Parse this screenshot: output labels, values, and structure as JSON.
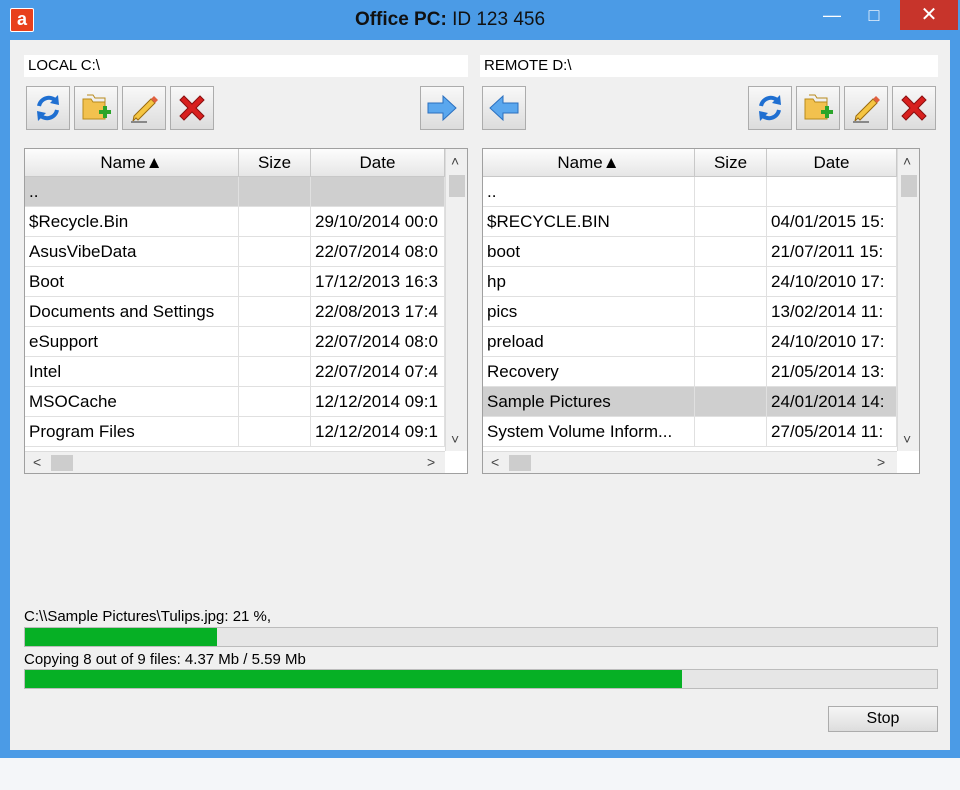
{
  "window": {
    "title_pc": "Office PC:",
    "title_id": " ID 123 456",
    "logo_letter": "a",
    "min_glyph": "—",
    "max_glyph": "□",
    "close_glyph": "✕"
  },
  "local": {
    "path": "LOCAL C:\\",
    "columns": [
      "Name▲",
      "Size",
      "Date"
    ],
    "rows": [
      {
        "name": "..",
        "size": "",
        "date": ""
      },
      {
        "name": "$Recycle.Bin",
        "size": "",
        "date": "29/10/2014  00:0"
      },
      {
        "name": "AsusVibeData",
        "size": "",
        "date": "22/07/2014  08:0"
      },
      {
        "name": "Boot",
        "size": "",
        "date": "17/12/2013  16:3"
      },
      {
        "name": "Documents and Settings",
        "size": "",
        "date": "22/08/2013  17:4"
      },
      {
        "name": "eSupport",
        "size": "",
        "date": "22/07/2014  08:0"
      },
      {
        "name": "Intel",
        "size": "",
        "date": "22/07/2014  07:4"
      },
      {
        "name": "MSOCache",
        "size": "",
        "date": "12/12/2014  09:1"
      },
      {
        "name": "Program Files",
        "size": "",
        "date": "12/12/2014  09:1"
      }
    ],
    "selected_index": 0
  },
  "remote": {
    "path": "REMOTE D:\\",
    "columns": [
      "Name▲",
      "Size",
      "Date"
    ],
    "rows": [
      {
        "name": "..",
        "size": "",
        "date": ""
      },
      {
        "name": "$RECYCLE.BIN",
        "size": "",
        "date": "04/01/2015  15:"
      },
      {
        "name": "boot",
        "size": "",
        "date": "21/07/2011  15:"
      },
      {
        "name": "hp",
        "size": "",
        "date": "24/10/2010  17:"
      },
      {
        "name": "pics",
        "size": "",
        "date": "13/02/2014  11:"
      },
      {
        "name": "preload",
        "size": "",
        "date": "24/10/2010  17:"
      },
      {
        "name": "Recovery",
        "size": "",
        "date": "21/05/2014  13:"
      },
      {
        "name": "Sample Pictures",
        "size": "",
        "date": "24/01/2014  14:"
      },
      {
        "name": "System Volume Inform...",
        "size": "",
        "date": "27/05/2014  11:"
      }
    ],
    "selected_index": 7
  },
  "scroll": {
    "up": "˄",
    "down": "˅",
    "left": "<",
    "right": ">"
  },
  "progress": {
    "file_status": "C:\\\\Sample Pictures\\Tulips.jpg: 21 %,",
    "file_fraction": 0.21,
    "total_status": "Copying 8 out of 9 files: 4.37 Mb / 5.59 Mb",
    "total_fraction": 0.72,
    "color": "#06b025"
  },
  "stop_label": "Stop",
  "icons": {
    "refresh": "refresh-icon",
    "new_folder": "new-folder-icon",
    "rename": "rename-pencil-icon",
    "delete": "delete-x-icon",
    "upload": "upload-arrow-right-icon",
    "download": "download-arrow-left-icon"
  }
}
